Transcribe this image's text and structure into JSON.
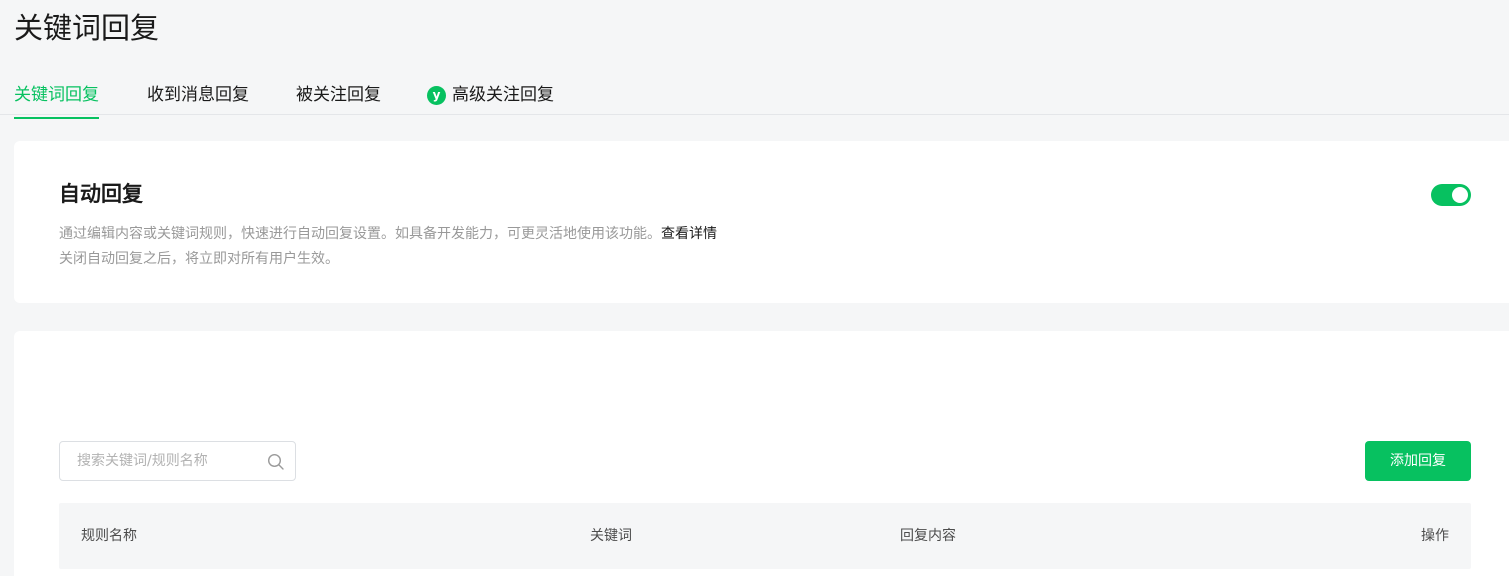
{
  "page": {
    "title": "关键词回复"
  },
  "tabs": [
    {
      "label": "关键词回复",
      "active": true
    },
    {
      "label": "收到消息回复",
      "active": false
    },
    {
      "label": "被关注回复",
      "active": false
    },
    {
      "label": "高级关注回复",
      "active": false,
      "icon": "verified-badge-icon",
      "icon_glyph": "y"
    }
  ],
  "auto_reply": {
    "title": "自动回复",
    "desc_line1": "通过编辑内容或关键词规则，快速进行自动回复设置。如具备开发能力，可更灵活地使用该功能。",
    "detail_link": "查看详情",
    "desc_line2": "关闭自动回复之后，将立即对所有用户生效。",
    "enabled": true
  },
  "rules": {
    "search_placeholder": "搜索关键词/规则名称",
    "search_value": "",
    "add_button": "添加回复",
    "columns": {
      "name": "规则名称",
      "keyword": "关键词",
      "content": "回复内容",
      "action": "操作"
    }
  },
  "colors": {
    "accent": "#07c160",
    "background": "#f5f6f7",
    "muted_text": "#999999"
  }
}
